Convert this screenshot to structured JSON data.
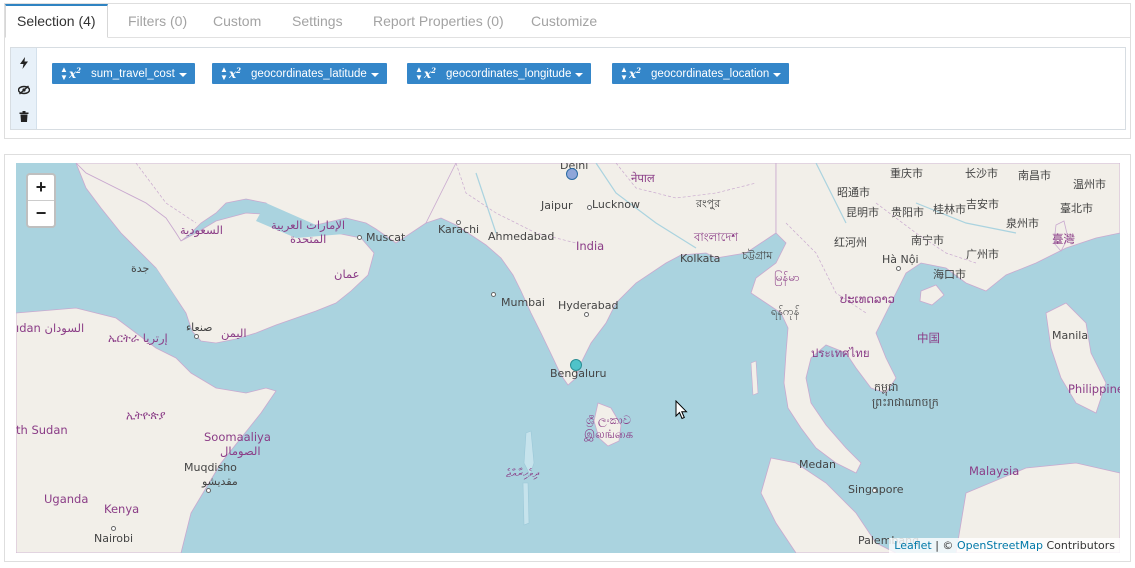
{
  "tabs": [
    {
      "label": "Selection (4)",
      "active": true
    },
    {
      "label": "Filters (0)"
    },
    {
      "label": "Custom"
    },
    {
      "label": "Settings"
    },
    {
      "label": "Report Properties (0)"
    },
    {
      "label": "Customize"
    }
  ],
  "tools": {
    "run_icon": "bolt-icon",
    "hide_icon": "eye-slash-icon",
    "delete_icon": "trash-icon"
  },
  "chips": [
    {
      "sort_icon": "sort-icon",
      "agg_icon": "x²",
      "label": "sum_travel_cost"
    },
    {
      "sort_icon": "sort-icon",
      "agg_icon": "x²",
      "label": "geocordinates_latitude"
    },
    {
      "sort_icon": "sort-icon",
      "agg_icon": "x²",
      "label": "geocordinates_longitude"
    },
    {
      "sort_icon": "sort-icon",
      "agg_icon": "x²",
      "label": "geocordinates_location"
    }
  ],
  "map": {
    "zoom_in": "+",
    "zoom_out": "−",
    "attribution": {
      "leaflet": "Leaflet",
      "separator": " | © ",
      "osm": "OpenStreetMap",
      "contributors": " Contributors"
    },
    "labels": {
      "delhi": "Delhi",
      "nepal": "नेपाल",
      "jaipur": "Jaipur",
      "lucknow": "Lucknow",
      "rangpur": "রংপুর",
      "karachi": "Karachi",
      "ahmedabad": "Ahmedabad",
      "india": "India",
      "bangladesh": "বাংলাদেশ",
      "chattogram": "চট্টগ্রাম",
      "kolkata": "Kolkata",
      "myanmar": "မြန်မာ",
      "mumbai": "Mumbai",
      "hyderabad": "Hyderabad",
      "yangon": "ရန်ကုန်",
      "bengaluru": "Bengaluru",
      "srilanka1": "ශ්‍රී ලංකාව",
      "srilanka2": "இலங்கை",
      "maldives": "ދިވެހިރާއްޖެ",
      "muscat": "Muscat",
      "oman": "عمان",
      "uae1": "الإمارات العربية",
      "uae2": "المتحدة",
      "saudi": "السعودية",
      "jeddah": "جدة",
      "yemen": "اليمن",
      "sanaa": "صنعاء",
      "eritrea": "ኤርትራ إرتريا",
      "sudan": "ıdan السودان",
      "ethiopia": "ኢትዮጵያ",
      "southsudan": "th Sudan",
      "somalia1": "Soomaaliya",
      "somalia2": "الصومال",
      "mogadishu1": "Muqdisho",
      "mogadishu2": "مقديشو",
      "uganda": "Uganda",
      "kenya": "Kenya",
      "nairobi": "Nairobi",
      "chongqing": "重庆市",
      "changsha": "长沙市",
      "nanchang": "南昌市",
      "wenzhou": "温州市",
      "zhaotong": "昭通市",
      "kunming": "昆明市",
      "guiyang": "贵阳市",
      "guilin": "桂林市",
      "jian": "吉安市",
      "quanzhou": "泉州市",
      "taipei": "臺北市",
      "taiwan": "臺灣",
      "honghe": "红河州",
      "nanning": "南宁市",
      "guangzhou": "广州市",
      "hanoi": "Hà Nội",
      "haikou": "海口市",
      "laos": "ປະເທດລາວ",
      "china": "中国",
      "thailand": "ประเทศไทย",
      "cambodia1": "កម្ពុជា",
      "cambodia2": "ព្រះរាជាណាចក្រ",
      "manila": "Manila",
      "philippines": "Philippines",
      "medan": "Medan",
      "singapore": "Singapore",
      "malaysia": "Malaysia",
      "palembang": "Palembang"
    },
    "markers": [
      {
        "name": "Delhi",
        "color": "#8fa6d9"
      },
      {
        "name": "Bengaluru",
        "color": "#4fc3c9"
      }
    ]
  }
}
